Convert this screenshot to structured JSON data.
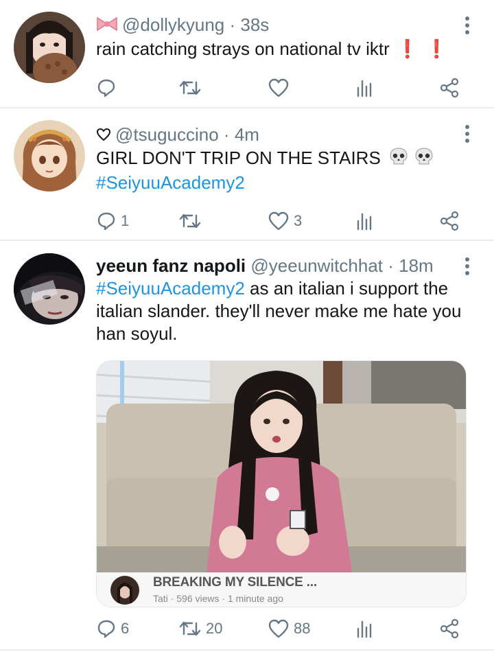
{
  "tweets": [
    {
      "handle": "@dollykyung",
      "time": "38s",
      "name_emoji": "bow-icon",
      "text": "rain catching strays on national tv iktr",
      "text_emoji": "double-exclamation",
      "actions": {
        "replies": "",
        "retweets": "",
        "likes": ""
      }
    },
    {
      "handle": "@tsuguccino",
      "time": "4m",
      "name_emoji": "heart-outline-icon",
      "text": "GIRL DON'T TRIP ON THE STAIRS",
      "text_emoji": "skull-icon",
      "hashtag": "#SeiyuuAcademy2",
      "actions": {
        "replies": "1",
        "retweets": "",
        "likes": "3"
      }
    },
    {
      "display_name": "yeeun fanz napoli",
      "handle": "@yeeunwitchhat",
      "time": "18m",
      "hashtag": "#SeiyuuAcademy2",
      "text": " as an italian i support the italian slander. they'll never make me hate you han soyul.",
      "media": {
        "title": "BREAKING MY SILENCE ...",
        "channel": "Tati",
        "views": "596 views",
        "ago": "1 minute ago"
      },
      "actions": {
        "replies": "6",
        "retweets": "20",
        "likes": "88"
      }
    }
  ],
  "separator": " · ",
  "colors": {
    "link": "#1b95e0",
    "secondary": "#657786",
    "border": "#e6ecf0",
    "alert": "#e0202a"
  }
}
